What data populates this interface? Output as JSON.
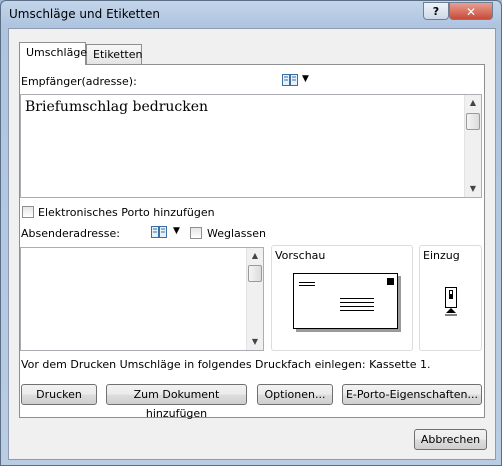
{
  "window": {
    "title": "Umschläge und Etiketten",
    "help_glyph": "?",
    "close_glyph": "✕"
  },
  "tabs": [
    {
      "label": "Umschläge",
      "active": true
    },
    {
      "label": "Etiketten",
      "active": false
    }
  ],
  "recipient": {
    "label": "Empfänger(adresse):",
    "value": "Briefumschlag bedrucken",
    "address_book_icon": "address-book-icon"
  },
  "epostage": {
    "label": "Elektronisches Porto hinzufügen",
    "checked": false
  },
  "sender": {
    "label": "Absenderadresse:",
    "value": "",
    "omit_label": "Weglassen",
    "omit_checked": false
  },
  "preview": {
    "label": "Vorschau"
  },
  "feed": {
    "label": "Einzug"
  },
  "info_text": "Vor dem Drucken Umschläge in folgendes Druckfach einlegen: Kassette 1.",
  "buttons": {
    "print": "Drucken",
    "add_to_document": "Zum Dokument hinzufügen",
    "options": "Optionen...",
    "eporto_properties": "E-Porto-Eigenschaften...",
    "cancel": "Abbrechen"
  },
  "colors": {
    "titlebar": "#b9cce3",
    "close_button": "#c94b38",
    "dialog_face": "#f0f0f0"
  }
}
